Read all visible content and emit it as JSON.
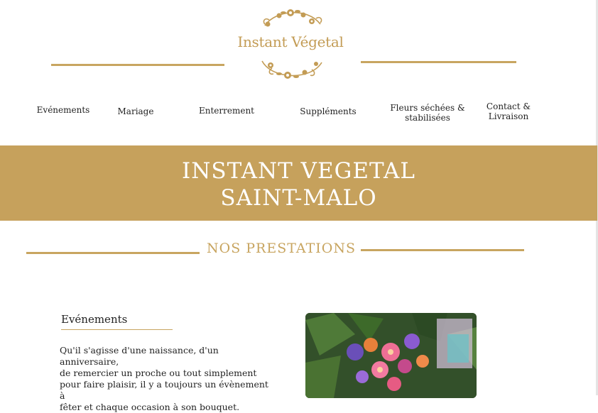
{
  "brand": {
    "logo_text": "Instant Végetal",
    "accent_color": "#c6a15c"
  },
  "nav": {
    "items": [
      {
        "lines": [
          "Evénements"
        ]
      },
      {
        "lines": [
          "Mariage"
        ]
      },
      {
        "lines": [
          "Enterrement"
        ]
      },
      {
        "lines": [
          "Suppléments"
        ]
      },
      {
        "lines": [
          "Fleurs séchées &",
          "stabilisées"
        ]
      },
      {
        "lines": [
          "Contact &",
          "Livraison"
        ]
      }
    ]
  },
  "banner": {
    "line1": "INSTANT VEGETAL",
    "line2": "SAINT-MALO"
  },
  "section": {
    "title": "NOS PRESTATIONS"
  },
  "events": {
    "title": "Evénements",
    "paragraph_lines": [
      "Qu'il s'agisse d'une naissance, d'un anniversaire,",
      "de remercier un proche ou tout simplement",
      "pour faire plaisir, il y a toujours un évènement à",
      "fêter et chaque occasion à son bouquet."
    ],
    "image_icon": "flower-bouquet-photo"
  }
}
